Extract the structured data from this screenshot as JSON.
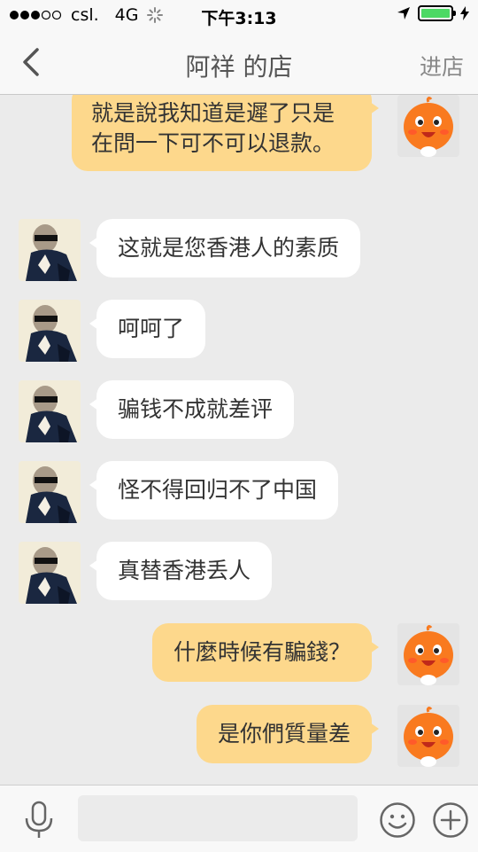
{
  "status_bar": {
    "carrier": "csl.",
    "network": "4G",
    "time": "下午3:13",
    "battery_color": "#4cd964"
  },
  "nav": {
    "title": "阿祥 的店",
    "right_action": "进店"
  },
  "messages": [
    {
      "side": "out",
      "text": "就是說我知道是遲了只是在問一下可不可以退款。"
    },
    {
      "side": "in",
      "text": "这就是您香港人的素质"
    },
    {
      "side": "in",
      "text": "呵呵了"
    },
    {
      "side": "in",
      "text": "骗钱不成就差评"
    },
    {
      "side": "in",
      "text": "怪不得回归不了中国"
    },
    {
      "side": "in",
      "text": "真替香港丢人"
    },
    {
      "side": "out",
      "text": "什麼時候有騙錢？"
    },
    {
      "side": "out",
      "text": "是你們質量差"
    }
  ],
  "input": {
    "placeholder": ""
  },
  "colors": {
    "outgoing_bubble": "#fdd88c",
    "incoming_bubble": "#ffffff",
    "background": "#ebebeb",
    "mascot": "#f97a1f"
  },
  "icons": {
    "back": "chevron-left-icon",
    "location": "location-arrow-icon",
    "mic": "microphone-icon",
    "emoji": "smiley-icon",
    "plus": "plus-circle-icon"
  }
}
